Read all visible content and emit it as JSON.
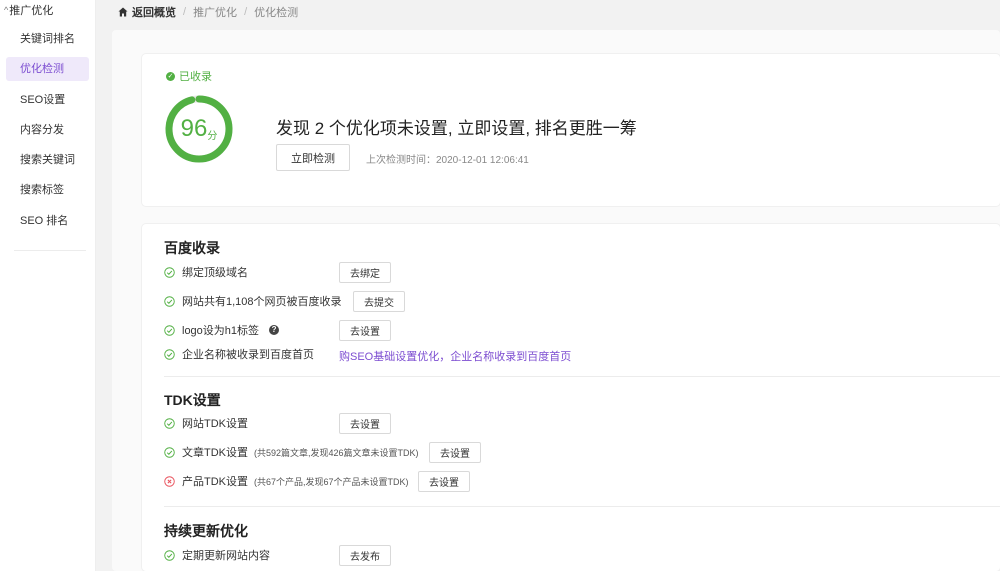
{
  "sidebar": {
    "group_label": "推广优化",
    "items": [
      {
        "label": "关键词排名"
      },
      {
        "label": "优化检测"
      },
      {
        "label": "SEO设置"
      },
      {
        "label": "内容分发"
      },
      {
        "label": "搜索关键词"
      },
      {
        "label": "搜索标签"
      },
      {
        "label": "SEO 排名"
      }
    ],
    "active_index": 1
  },
  "breadcrumb": {
    "home_label": "返回概览",
    "items": [
      "推广优化",
      "优化检测"
    ]
  },
  "score_card": {
    "status": "已收录",
    "score": 96,
    "score_unit": "分",
    "score_max": 100,
    "headline": "发现 2 个优化项未设置, 立即设置, 排名更胜一筹",
    "check_button": "立即检测",
    "last_check": "上次检测时间：2020-12-01 12:06:41"
  },
  "sections": [
    {
      "title": "百度收录",
      "items": [
        {
          "label": "绑定顶级域名",
          "status": "ok",
          "button": "去绑定"
        },
        {
          "label": "网站共有1,108个网页被百度收录",
          "status": "ok",
          "button": "去提交"
        },
        {
          "label": "logo设为h1标签",
          "status": "ok",
          "button": "去设置",
          "help": "?"
        },
        {
          "label": "企业名称被收录到百度首页",
          "status": "ok",
          "link": "购SEO基础设置优化，企业名称收录到百度首页"
        }
      ]
    },
    {
      "title": "TDK设置",
      "items": [
        {
          "label": "网站TDK设置",
          "status": "ok",
          "button": "去设置"
        },
        {
          "label": "文章TDK设置",
          "note": "(共592篇文章,发现426篇文章未设置TDK)",
          "status": "ok",
          "button": "去设置"
        },
        {
          "label": "产品TDK设置",
          "note": "(共67个产品,发现67个产品未设置TDK)",
          "status": "error",
          "button": "去设置"
        }
      ]
    },
    {
      "title": "持续更新优化",
      "items": [
        {
          "label": "定期更新网站内容",
          "status": "ok",
          "button": "去发布"
        }
      ]
    }
  ],
  "colors": {
    "accent": "#7c4dd1",
    "ok": "#52b043",
    "error": "#e8505b"
  }
}
